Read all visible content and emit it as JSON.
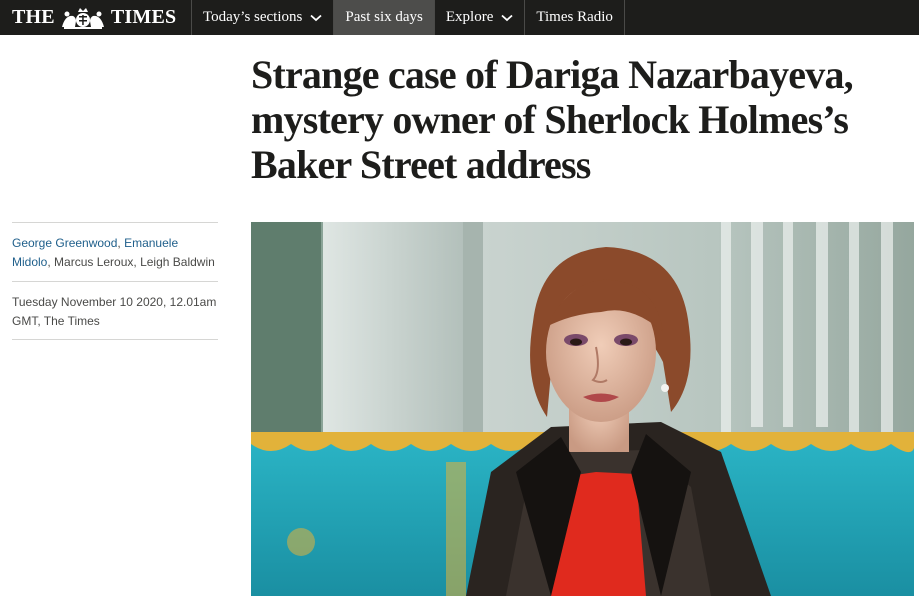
{
  "masthead": {
    "logo_left": "THE",
    "logo_right": "TIMES",
    "crest_icon": "royal-crest-icon"
  },
  "nav": {
    "items": [
      {
        "label": "Today’s sections",
        "has_dropdown": true,
        "active": false
      },
      {
        "label": "Past six days",
        "has_dropdown": false,
        "active": true
      },
      {
        "label": "Explore",
        "has_dropdown": true,
        "active": false
      },
      {
        "label": "Times Radio",
        "has_dropdown": false,
        "active": false
      }
    ]
  },
  "article": {
    "headline": "Strange case of Dariga Nazarbayeva, mystery owner of Sherlock Holmes’s Baker Street address",
    "authors_linked": [
      "George Greenwood",
      "Emanuele Midolo"
    ],
    "authors_plain": "Marcus Leroux, Leigh Baldwin",
    "separator": ", ",
    "dateline": "Tuesday November 10 2020, 12.01am GMT, The Times"
  },
  "colors": {
    "topbar_bg": "#1d1d1b",
    "active_nav_bg": "#4d4d4b",
    "author_link": "#1f5f8b",
    "rule": "#d6d6d4"
  }
}
